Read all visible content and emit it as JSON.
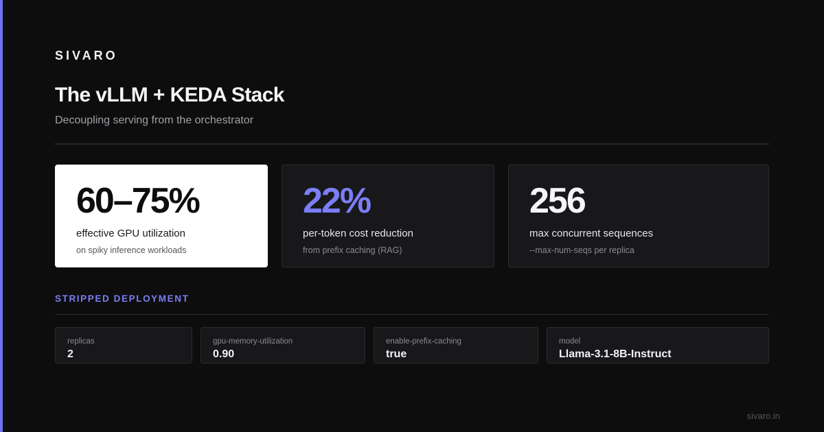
{
  "brand": "SIVARO",
  "title": "The vLLM + KEDA Stack",
  "subtitle": "Decoupling serving from the orchestrator",
  "stats": [
    {
      "value": "60–75%",
      "label": "effective GPU utilization",
      "sub": "on spiky inference workloads"
    },
    {
      "value": "22%",
      "label": "per-token cost reduction",
      "sub": "from prefix caching (RAG)"
    },
    {
      "value": "256",
      "label": "max concurrent sequences",
      "sub": "--max-num-seqs per replica"
    }
  ],
  "section_heading": "STRIPPED DEPLOYMENT",
  "config": [
    {
      "key": "replicas",
      "value": "2"
    },
    {
      "key": "gpu-memory-utilization",
      "value": "0.90"
    },
    {
      "key": "enable-prefix-caching",
      "value": "true"
    },
    {
      "key": "model",
      "value": "Llama-3.1-8B-Instruct"
    }
  ],
  "footer": "sivaro.in",
  "colors": {
    "background": "#0d0d0e",
    "accent": "#6f72f0",
    "accent_text": "#7b7ef5",
    "card": "#18181a",
    "highlight_card": "#ffffff"
  }
}
